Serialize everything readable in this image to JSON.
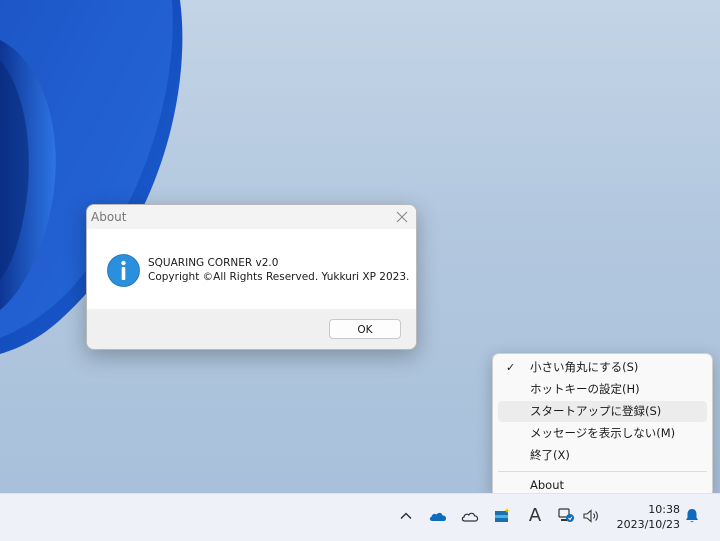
{
  "dialog": {
    "title": "About",
    "app_name": "SQUARING CORNER v2.0",
    "copyright": "Copyright ©All Rights Reserved. Yukkuri XP 2023.",
    "ok_label": "OK"
  },
  "menu": {
    "items": [
      {
        "label": "小さい角丸にする(S)",
        "checked": true
      },
      {
        "label": "ホットキーの設定(H)",
        "checked": false
      },
      {
        "label": "スタートアップに登録(S)",
        "checked": false,
        "highlighted": true
      },
      {
        "label": "メッセージを表示しない(M)",
        "checked": false
      },
      {
        "label": "終了(X)",
        "checked": false
      },
      {
        "label": "About",
        "checked": false
      }
    ],
    "check_glyph": "✓"
  },
  "taskbar": {
    "time": "10:38",
    "date": "2023/10/23",
    "ime_label": "A",
    "icons": [
      "chevron-up-icon",
      "onedrive-blue-icon",
      "onedrive-icon",
      "app-icon",
      "ime-icon",
      "network-icon",
      "volume-icon",
      "bell-icon"
    ]
  },
  "colors": {
    "accent": "#0f6cbd",
    "info_icon": "#2a8fdc",
    "wallpaper_blue": "#1a55c5"
  }
}
